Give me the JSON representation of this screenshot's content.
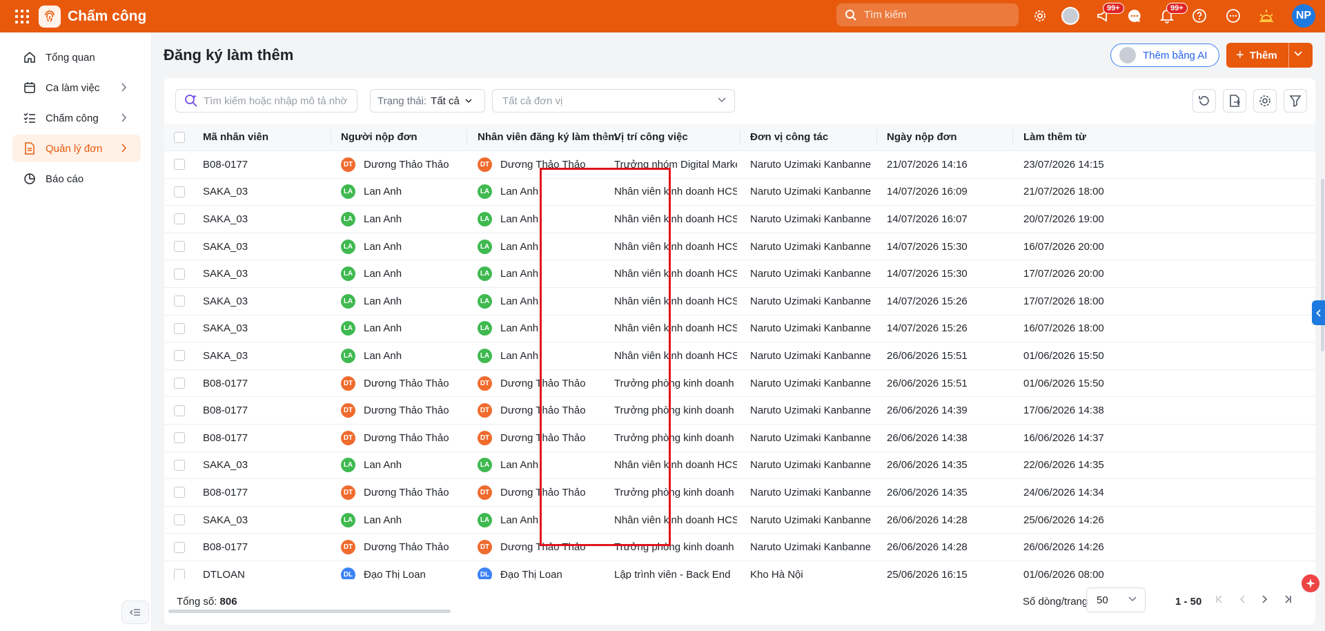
{
  "app": {
    "title": "Chấm công"
  },
  "topbar": {
    "search_placeholder": "Tìm kiếm",
    "megaphone_badge": "99+",
    "bell_badge": "99+",
    "user_initials": "NP"
  },
  "sidebar": {
    "items": [
      {
        "label": "Tổng quan",
        "icon": "home-icon"
      },
      {
        "label": "Ca làm việc",
        "icon": "calendar-icon"
      },
      {
        "label": "Chấm công",
        "icon": "checklist-icon"
      },
      {
        "label": "Quản lý đơn",
        "icon": "document-icon"
      },
      {
        "label": "Báo cáo",
        "icon": "pie-chart-icon"
      }
    ]
  },
  "page": {
    "title": "Đăng ký làm thêm",
    "ai_button": "Thêm bằng AI",
    "add_button": "Thêm"
  },
  "filters": {
    "search_placeholder": "Tìm kiếm hoặc nhập mô tả nhờ",
    "status_label": "Trạng thái:",
    "status_value": "Tất cả",
    "unit_placeholder": "Tất cả đơn vị"
  },
  "table": {
    "columns": [
      "Mã nhân viên",
      "Người nộp đơn",
      "Nhân viên đăng ký làm thêm",
      "Vị trí công việc",
      "Đơn vị công tác",
      "Ngày nộp đơn",
      "Làm thêm từ"
    ],
    "rows": [
      {
        "code": "B08-0177",
        "submitter": "Dương Thảo Thảo",
        "submitter_initials": "DT",
        "employee": "Dương Thảo Thảo",
        "employee_initials": "DT",
        "position": "Trưởng nhóm Digital Marketing",
        "unit": "Naruto Uzimaki Kanbanne",
        "submitted": "21/07/2026 14:16",
        "from": "23/07/2026 14:15"
      },
      {
        "code": "SAKA_03",
        "submitter": "Lan Anh",
        "submitter_initials": "LA",
        "employee": "Lan Anh",
        "employee_initials": "LA",
        "position": "Nhân viên kinh doanh HCSN",
        "unit": "Naruto Uzimaki Kanbanne",
        "submitted": "14/07/2026 16:09",
        "from": "21/07/2026 18:00"
      },
      {
        "code": "SAKA_03",
        "submitter": "Lan Anh",
        "submitter_initials": "LA",
        "employee": "Lan Anh",
        "employee_initials": "LA",
        "position": "Nhân viên kinh doanh HCSN",
        "unit": "Naruto Uzimaki Kanbanne",
        "submitted": "14/07/2026 16:07",
        "from": "20/07/2026 19:00"
      },
      {
        "code": "SAKA_03",
        "submitter": "Lan Anh",
        "submitter_initials": "LA",
        "employee": "Lan Anh",
        "employee_initials": "LA",
        "position": "Nhân viên kinh doanh HCSN",
        "unit": "Naruto Uzimaki Kanbanne",
        "submitted": "14/07/2026 15:30",
        "from": "16/07/2026 20:00"
      },
      {
        "code": "SAKA_03",
        "submitter": "Lan Anh",
        "submitter_initials": "LA",
        "employee": "Lan Anh",
        "employee_initials": "LA",
        "position": "Nhân viên kinh doanh HCSN",
        "unit": "Naruto Uzimaki Kanbanne",
        "submitted": "14/07/2026 15:30",
        "from": "17/07/2026 20:00"
      },
      {
        "code": "SAKA_03",
        "submitter": "Lan Anh",
        "submitter_initials": "LA",
        "employee": "Lan Anh",
        "employee_initials": "LA",
        "position": "Nhân viên kinh doanh HCSN",
        "unit": "Naruto Uzimaki Kanbanne",
        "submitted": "14/07/2026 15:26",
        "from": "17/07/2026 18:00"
      },
      {
        "code": "SAKA_03",
        "submitter": "Lan Anh",
        "submitter_initials": "LA",
        "employee": "Lan Anh",
        "employee_initials": "LA",
        "position": "Nhân viên kinh doanh HCSN",
        "unit": "Naruto Uzimaki Kanbanne",
        "submitted": "14/07/2026 15:26",
        "from": "16/07/2026 18:00"
      },
      {
        "code": "SAKA_03",
        "submitter": "Lan Anh",
        "submitter_initials": "LA",
        "employee": "Lan Anh",
        "employee_initials": "LA",
        "position": "Nhân viên kinh doanh HCSN",
        "unit": "Naruto Uzimaki Kanbanne",
        "submitted": "26/06/2026 15:51",
        "from": "01/06/2026 15:50"
      },
      {
        "code": "B08-0177",
        "submitter": "Dương Thảo Thảo",
        "submitter_initials": "DT",
        "employee": "Dương Thảo Thảo",
        "employee_initials": "DT",
        "position": "Trưởng phòng kinh doanh HCSN",
        "unit": "Naruto Uzimaki Kanbanne",
        "submitted": "26/06/2026 15:51",
        "from": "01/06/2026 15:50"
      },
      {
        "code": "B08-0177",
        "submitter": "Dương Thảo Thảo",
        "submitter_initials": "DT",
        "employee": "Dương Thảo Thảo",
        "employee_initials": "DT",
        "position": "Trưởng phòng kinh doanh HCSN",
        "unit": "Naruto Uzimaki Kanbanne",
        "submitted": "26/06/2026 14:39",
        "from": "17/06/2026 14:38"
      },
      {
        "code": "B08-0177",
        "submitter": "Dương Thảo Thảo",
        "submitter_initials": "DT",
        "employee": "Dương Thảo Thảo",
        "employee_initials": "DT",
        "position": "Trưởng phòng kinh doanh HCSN",
        "unit": "Naruto Uzimaki Kanbanne",
        "submitted": "26/06/2026 14:38",
        "from": "16/06/2026 14:37"
      },
      {
        "code": "SAKA_03",
        "submitter": "Lan Anh",
        "submitter_initials": "LA",
        "employee": "Lan Anh",
        "employee_initials": "LA",
        "position": "Nhân viên kinh doanh HCSN",
        "unit": "Naruto Uzimaki Kanbanne",
        "submitted": "26/06/2026 14:35",
        "from": "22/06/2026 14:35"
      },
      {
        "code": "B08-0177",
        "submitter": "Dương Thảo Thảo",
        "submitter_initials": "DT",
        "employee": "Dương Thảo Thảo",
        "employee_initials": "DT",
        "position": "Trưởng phòng kinh doanh HCSN",
        "unit": "Naruto Uzimaki Kanbanne",
        "submitted": "26/06/2026 14:35",
        "from": "24/06/2026 14:34"
      },
      {
        "code": "SAKA_03",
        "submitter": "Lan Anh",
        "submitter_initials": "LA",
        "employee": "Lan Anh",
        "employee_initials": "LA",
        "position": "Nhân viên kinh doanh HCSN",
        "unit": "Naruto Uzimaki Kanbanne",
        "submitted": "26/06/2026 14:28",
        "from": "25/06/2026 14:26"
      },
      {
        "code": "B08-0177",
        "submitter": "Dương Thảo Thảo",
        "submitter_initials": "DT",
        "employee": "Dương Thảo Thảo",
        "employee_initials": "DT",
        "position": "Trưởng phòng kinh doanh HCSN",
        "unit": "Naruto Uzimaki Kanbanne",
        "submitted": "26/06/2026 14:28",
        "from": "26/06/2026 14:26"
      },
      {
        "code": "DTLOAN",
        "submitter": "Đạo Thị Loan",
        "submitter_initials": "DL",
        "employee": "Đạo Thị Loan",
        "employee_initials": "DL",
        "position": "Lập trình viên - Back End",
        "unit": "Kho Hà Nội",
        "submitted": "25/06/2026 16:15",
        "from": "01/06/2026 08:00"
      }
    ]
  },
  "avatar_colors": {
    "DT": "#f06b2d",
    "LA": "#3fb950",
    "DL": "#3b82f6"
  },
  "footer": {
    "total_label": "Tổng số:",
    "total_value": "806",
    "rows_per_page_label": "Số dòng/trang",
    "rows_per_page_value": "50",
    "range": "1 - 50"
  },
  "colors": {
    "brand": "#e8590c",
    "highlight": "#e0131c"
  }
}
